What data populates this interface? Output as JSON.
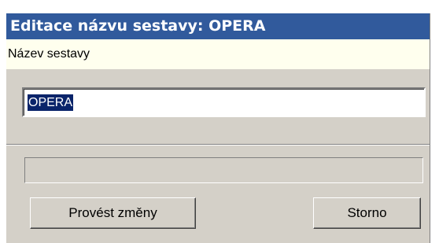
{
  "window": {
    "title": "Editace názvu sestavy: OPERA"
  },
  "form": {
    "name_label": "Název sestavy",
    "name_value": "OPERA",
    "status_text": ""
  },
  "buttons": {
    "apply_label": "Provést změny",
    "cancel_label": "Storno"
  },
  "colors": {
    "title_bar": "#315a9c",
    "label_band": "#ffffee",
    "dialog_face": "#d4d0c8",
    "selection": "#0a246a"
  }
}
